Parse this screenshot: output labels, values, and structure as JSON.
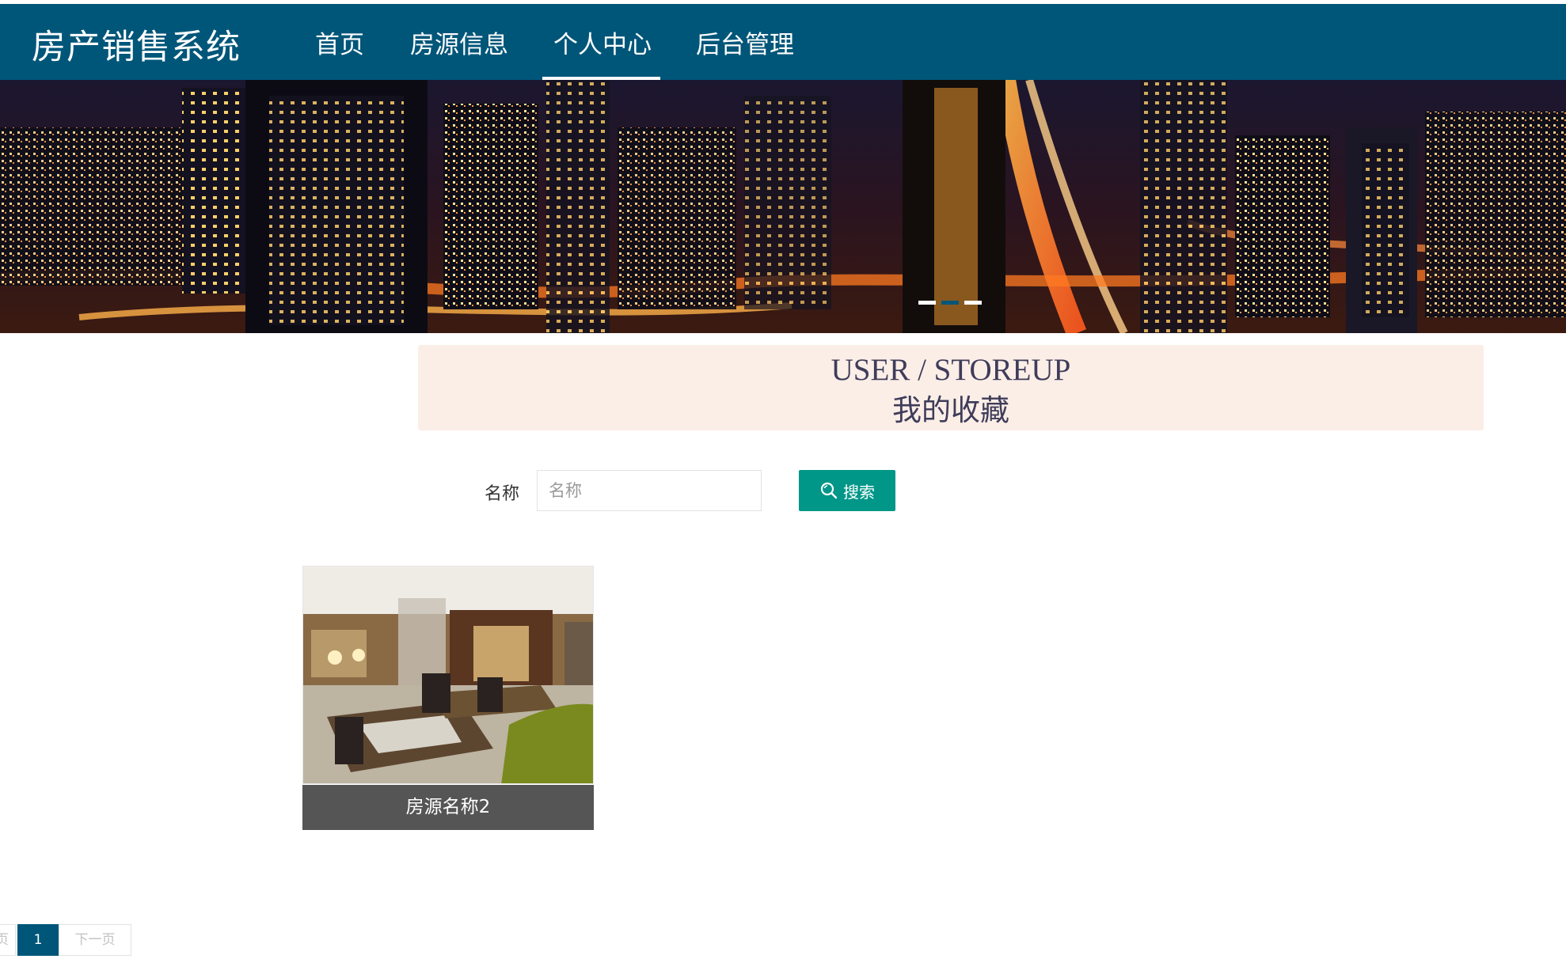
{
  "header": {
    "brand": "房产销售系统",
    "nav": [
      {
        "label": "首页"
      },
      {
        "label": "房源信息"
      },
      {
        "label": "个人中心",
        "active": true
      },
      {
        "label": "后台管理"
      }
    ]
  },
  "banner": {
    "image": "night-city-skyline",
    "active_slide": 2,
    "slides": 3
  },
  "title": {
    "en": "USER / STOREUP",
    "cn": "我的收藏"
  },
  "search": {
    "label": "名称",
    "placeholder": "名称",
    "value": "",
    "button": "搜索",
    "icon": "search-icon"
  },
  "items": [
    {
      "name": "房源名称2",
      "image": "hotel-dining-room"
    }
  ],
  "pagination": {
    "prev": "上一页",
    "current": "1",
    "next": "下一页"
  },
  "colors": {
    "header": "#005679",
    "button": "#009688",
    "title_bg": "#fbeee7",
    "caption_bg": "#555555"
  }
}
